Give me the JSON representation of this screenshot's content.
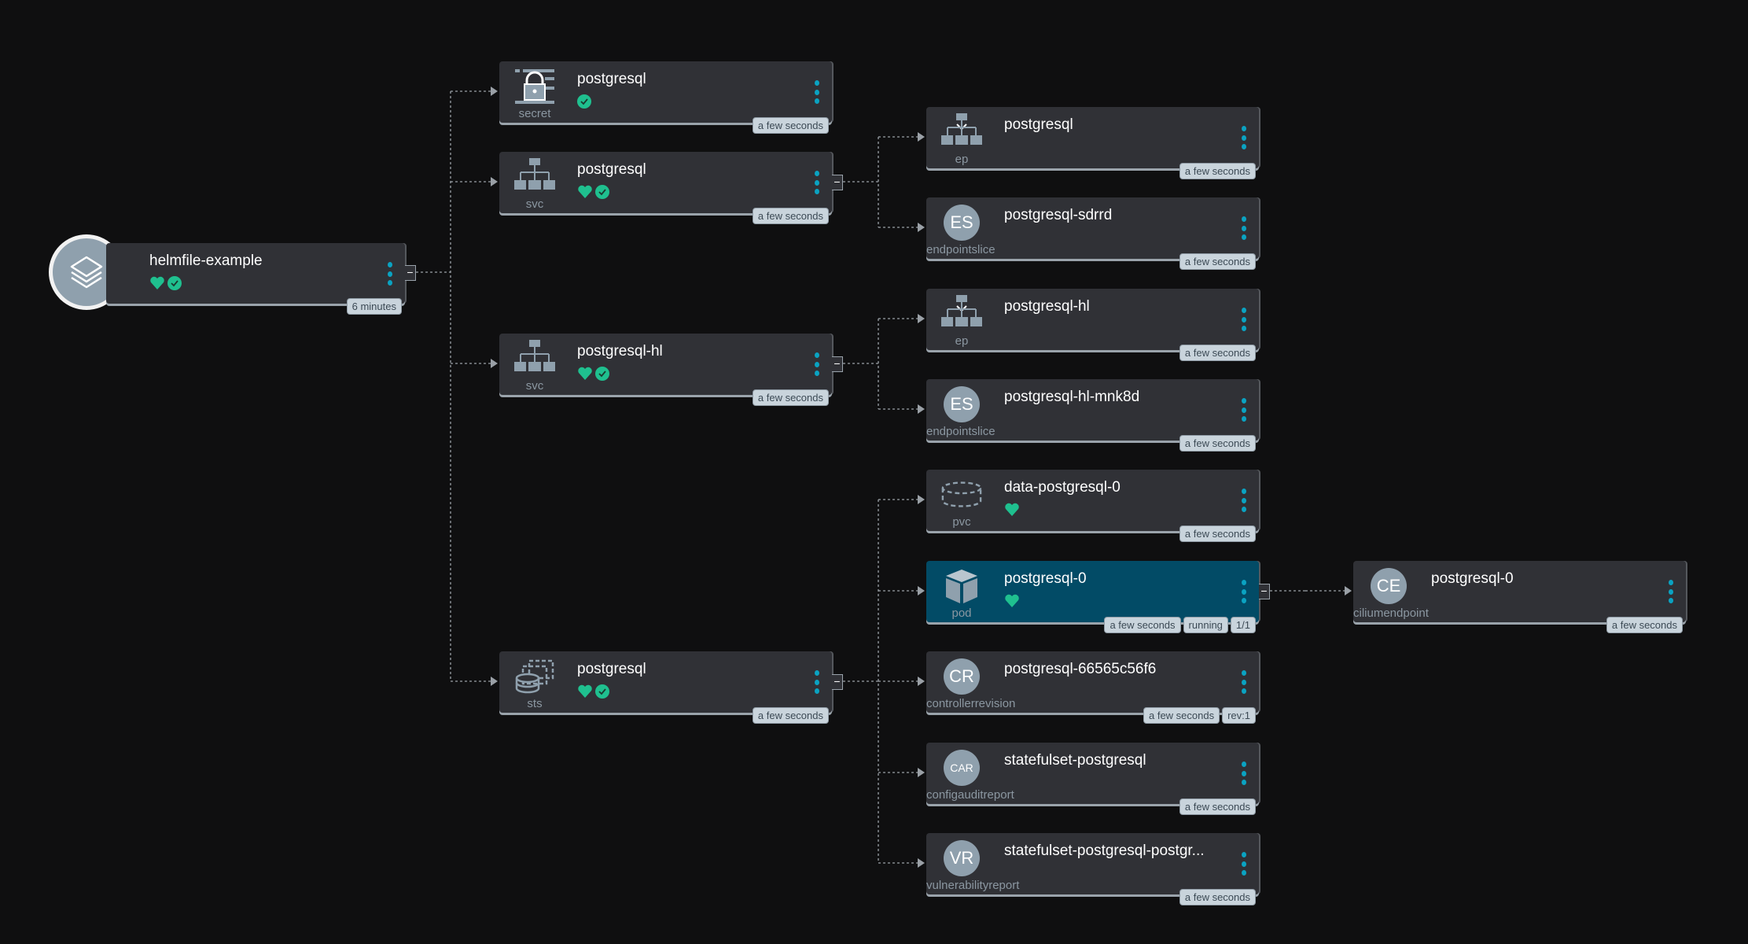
{
  "colors": {
    "background": "#0f0f10",
    "card": "#303136",
    "selected_card": "#024b66",
    "accent": "#0aa3c2",
    "healthy": "#1fc08f",
    "icon": "#8fa0ad"
  },
  "root": {
    "name": "helmfile-example",
    "icon": "layers-icon",
    "health": [
      "heart",
      "check"
    ],
    "badges": [
      "6 minutes"
    ]
  },
  "nodes": [
    {
      "name": "postgresql",
      "kind": "secret",
      "icon": "secret",
      "health": [
        "check"
      ],
      "badges": [
        "a few seconds"
      ]
    },
    {
      "name": "postgresql",
      "kind": "svc",
      "icon": "network",
      "health": [
        "heart",
        "check"
      ],
      "badges": [
        "a few seconds"
      ]
    },
    {
      "name": "postgresql-hl",
      "kind": "svc",
      "icon": "network",
      "health": [
        "heart",
        "check"
      ],
      "badges": [
        "a few seconds"
      ]
    },
    {
      "name": "postgresql",
      "kind": "sts",
      "icon": "sts",
      "health": [
        "heart",
        "check"
      ],
      "badges": [
        "a few seconds"
      ]
    },
    {
      "name": "postgresql",
      "kind": "ep",
      "icon": "ep",
      "health": [],
      "badges": [
        "a few seconds"
      ]
    },
    {
      "name": "postgresql-sdrrd",
      "kind": "endpointslice",
      "icon": "letter",
      "letter": "ES",
      "health": [],
      "badges": [
        "a few seconds"
      ]
    },
    {
      "name": "postgresql-hl",
      "kind": "ep",
      "icon": "ep",
      "health": [],
      "badges": [
        "a few seconds"
      ]
    },
    {
      "name": "postgresql-hl-mnk8d",
      "kind": "endpointslice",
      "icon": "letter",
      "letter": "ES",
      "health": [],
      "badges": [
        "a few seconds"
      ]
    },
    {
      "name": "data-postgresql-0",
      "kind": "pvc",
      "icon": "pvc",
      "health": [
        "heart"
      ],
      "badges": [
        "a few seconds"
      ]
    },
    {
      "name": "postgresql-0",
      "kind": "pod",
      "icon": "pod",
      "health": [
        "heart"
      ],
      "badges": [
        "a few seconds",
        "running",
        "1/1"
      ],
      "selected": true
    },
    {
      "name": "postgresql-66565c56f6",
      "kind": "controllerrevision",
      "icon": "letter",
      "letter": "CR",
      "health": [],
      "badges": [
        "a few seconds",
        "rev:1"
      ]
    },
    {
      "name": "statefulset-postgresql",
      "kind": "configauditreport",
      "icon": "letter",
      "letter": "CAR",
      "health": [],
      "badges": [
        "a few seconds"
      ]
    },
    {
      "name": "statefulset-postgresql-postgr...",
      "kind": "vulnerabilityreport",
      "icon": "letter",
      "letter": "VR",
      "health": [],
      "badges": [
        "a few seconds"
      ]
    },
    {
      "name": "postgresql-0",
      "kind": "ciliumendpoint",
      "icon": "letter",
      "letter": "CE",
      "health": [],
      "badges": [
        "a few seconds"
      ]
    }
  ],
  "collapse_label": "−"
}
